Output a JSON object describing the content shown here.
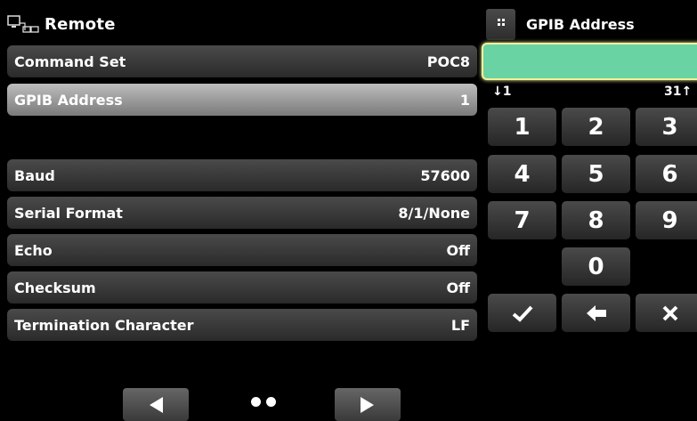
{
  "header": {
    "title": "Remote",
    "icon": "remote-computer-icon"
  },
  "settings": {
    "rows": [
      {
        "label": "Command Set",
        "value": "POC8"
      },
      {
        "label": "GPIB Address",
        "value": "1"
      },
      {
        "label": "Baud",
        "value": "57600"
      },
      {
        "label": "Serial Format",
        "value": "8/1/None"
      },
      {
        "label": "Echo",
        "value": "Off"
      },
      {
        "label": "Checksum",
        "value": "Off"
      },
      {
        "label": "Termination Character",
        "value": "LF"
      }
    ],
    "selected_row": "GPIB Address"
  },
  "pager": {
    "page_dots": 2
  },
  "keypad": {
    "title": "GPIB Address",
    "input_value": "",
    "range_min": "↓1",
    "range_max": "31↑",
    "keys": [
      "1",
      "2",
      "3",
      "4",
      "5",
      "6",
      "7",
      "8",
      "9",
      "0"
    ]
  },
  "colors": {
    "input_fill": "#6ad3a4",
    "input_border": "#f1f19a",
    "selected_row": "#bdbdbd"
  }
}
